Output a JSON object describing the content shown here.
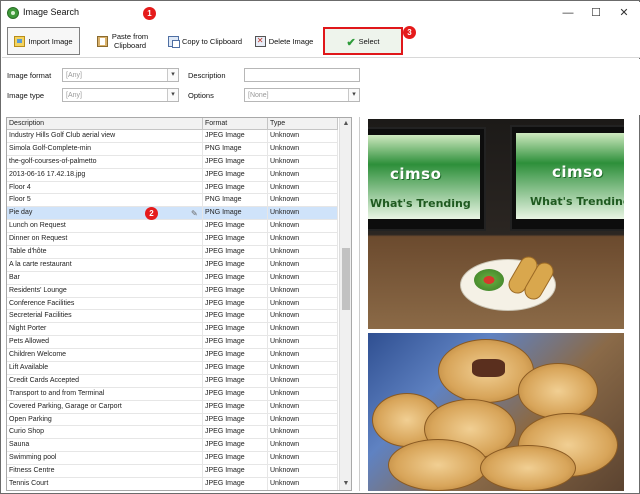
{
  "window": {
    "title": "Image Search",
    "controls": {
      "minimize": "—",
      "maximize": "☐",
      "close": "✕"
    }
  },
  "toolbar": {
    "import_label": "Import Image",
    "paste_label": "Paste from Clipboard",
    "copy_label": "Copy to Clipboard",
    "delete_label": "Delete Image",
    "select_label": "Select"
  },
  "badges": {
    "one": "1",
    "two": "2",
    "three": "3"
  },
  "filters": {
    "image_format_label": "Image format",
    "image_format_value": "[Any]",
    "image_type_label": "Image type",
    "image_type_value": "[Any]",
    "description_label": "Description",
    "description_value": "",
    "options_label": "Options",
    "options_value": "[None]"
  },
  "table": {
    "columns": [
      "Description",
      "Format",
      "Type"
    ],
    "rows": [
      [
        "Industry Hills Golf Club aerial view",
        "JPEG Image",
        "Unknown"
      ],
      [
        "Simola Golf-Complete-min",
        "PNG Image",
        "Unknown"
      ],
      [
        "the-golf-courses-of-palmetto",
        "JPEG Image",
        "Unknown"
      ],
      [
        "2013-06-16 17.42.18.jpg",
        "JPEG Image",
        "Unknown"
      ],
      [
        "Floor 4",
        "JPEG Image",
        "Unknown"
      ],
      [
        "Floor 5",
        "PNG Image",
        "Unknown"
      ],
      [
        "Pie day",
        "PNG Image",
        "Unknown"
      ],
      [
        "Lunch on Request",
        "JPEG Image",
        "Unknown"
      ],
      [
        "Dinner on Request",
        "JPEG Image",
        "Unknown"
      ],
      [
        "Table d'hôte",
        "JPEG Image",
        "Unknown"
      ],
      [
        "A la carte restaurant",
        "JPEG Image",
        "Unknown"
      ],
      [
        "Bar",
        "JPEG Image",
        "Unknown"
      ],
      [
        "Residents' Lounge",
        "JPEG Image",
        "Unknown"
      ],
      [
        "Conference Facilities",
        "JPEG Image",
        "Unknown"
      ],
      [
        "Secreterial Facilities",
        "JPEG Image",
        "Unknown"
      ],
      [
        "Night Porter",
        "JPEG Image",
        "Unknown"
      ],
      [
        "Pets Allowed",
        "JPEG Image",
        "Unknown"
      ],
      [
        "Children Welcome",
        "JPEG Image",
        "Unknown"
      ],
      [
        "Lift Available",
        "JPEG Image",
        "Unknown"
      ],
      [
        "Credit Cards Accepted",
        "JPEG Image",
        "Unknown"
      ],
      [
        "Transport to and from Terminal",
        "JPEG Image",
        "Unknown"
      ],
      [
        "Covered Parking, Garage or Carport",
        "JPEG Image",
        "Unknown"
      ],
      [
        "Open Parking",
        "JPEG Image",
        "Unknown"
      ],
      [
        "Curio Shop",
        "JPEG Image",
        "Unknown"
      ],
      [
        "Sauna",
        "JPEG Image",
        "Unknown"
      ],
      [
        "Swimming pool",
        "JPEG Image",
        "Unknown"
      ],
      [
        "Fitness Centre",
        "JPEG Image",
        "Unknown"
      ],
      [
        "Tennis Court",
        "JPEG Image",
        "Unknown"
      ]
    ],
    "selected_index": 6
  },
  "preview": {
    "screen_logo": "cimso",
    "screen_headline": "What's Trending"
  },
  "colors": {
    "select_highlight": "#e0171a",
    "badge": "#e51b1b",
    "selected_row": "#cfe3fa",
    "check": "#2d9b3a"
  }
}
